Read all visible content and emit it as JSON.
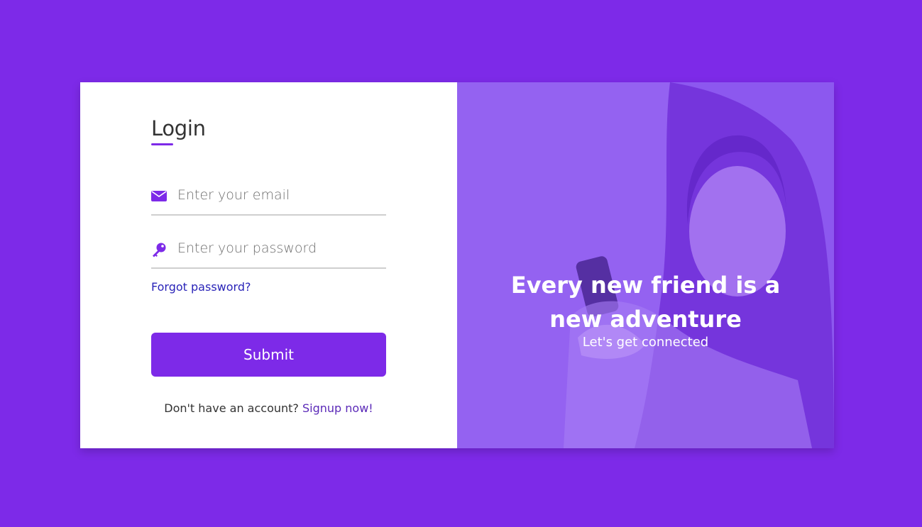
{
  "login": {
    "title": "Login",
    "email_placeholder": "Enter your email",
    "password_placeholder": "Enter your password",
    "forgot_label": "Forgot password?",
    "submit_label": "Submit",
    "signup_prompt": "Don't have an account?",
    "signup_link": "Signup now!"
  },
  "promo": {
    "headline_line1": "Every new friend is a",
    "headline_line2": "new adventure",
    "tagline": "Let's get connected"
  },
  "icons": {
    "email": "envelope-icon",
    "password": "key-icon"
  },
  "colors": {
    "accent": "#7d2ae8",
    "link": "#2a24b8",
    "overlay": "#8a55ee"
  }
}
